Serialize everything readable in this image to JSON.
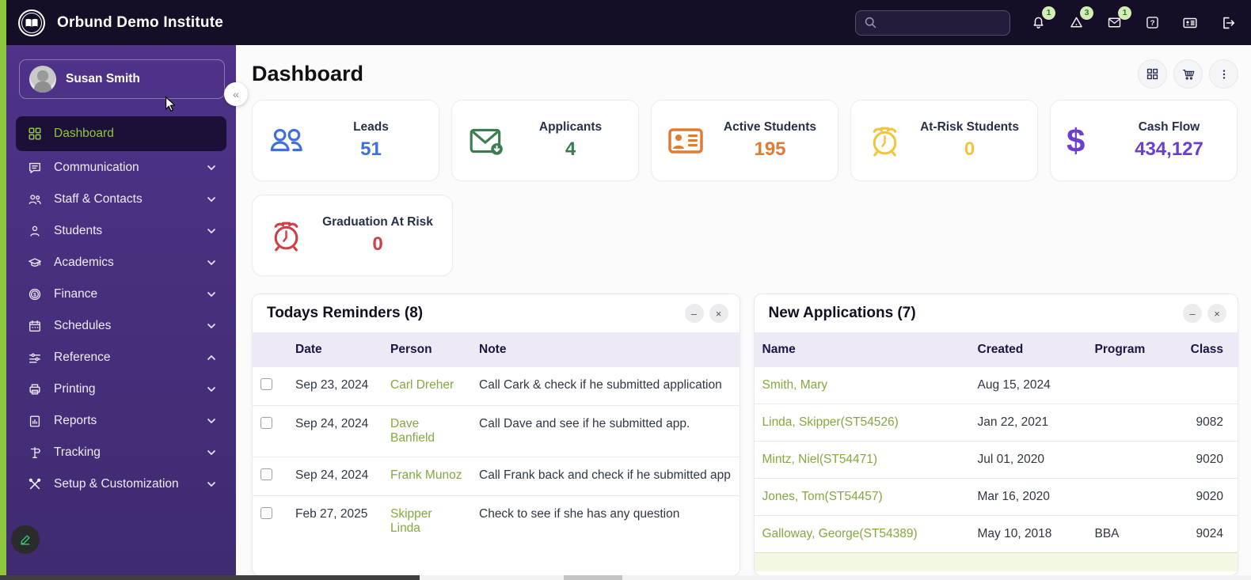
{
  "theme": {
    "topbar_bg": "#150e26",
    "sidebar_bg": "#4e3389",
    "accent_lime": "#8dc63f",
    "link_green": "#84a83e",
    "table_header_bg": "#edeaf6"
  },
  "topbar": {
    "brand": "Orbund Demo Institute",
    "search": {
      "value": "",
      "placeholder": ""
    },
    "badges": {
      "bell": "1",
      "alarm": "3",
      "mail": "1"
    }
  },
  "sidebar": {
    "user": {
      "name": "Susan Smith"
    },
    "collapse_glyph": "«",
    "items": [
      {
        "label": "Dashboard",
        "icon": "grid-icon",
        "active": true,
        "chevron": "none"
      },
      {
        "label": "Communication",
        "icon": "chat-icon",
        "chevron": "down"
      },
      {
        "label": "Staff & Contacts",
        "icon": "people-icon",
        "chevron": "down"
      },
      {
        "label": "Students",
        "icon": "person-icon",
        "chevron": "down"
      },
      {
        "label": "Academics",
        "icon": "grad-cap-icon",
        "chevron": "down"
      },
      {
        "label": "Finance",
        "icon": "coin-icon",
        "chevron": "down"
      },
      {
        "label": "Schedules",
        "icon": "calendar-icon",
        "chevron": "down"
      },
      {
        "label": "Reference",
        "icon": "sliders-icon",
        "chevron": "up"
      },
      {
        "label": "Printing",
        "icon": "printer-icon",
        "chevron": "down"
      },
      {
        "label": "Reports",
        "icon": "report-icon",
        "chevron": "down"
      },
      {
        "label": "Tracking",
        "icon": "signpost-icon",
        "chevron": "down"
      },
      {
        "label": "Setup & Customization",
        "icon": "tools-icon",
        "chevron": "down"
      }
    ]
  },
  "page": {
    "title": "Dashboard"
  },
  "stats": [
    {
      "label": "Leads",
      "value": "51",
      "color": "#3e6ee0",
      "icon": "leads-people-icon"
    },
    {
      "label": "Applicants",
      "value": "4",
      "color": "#3a7d4f",
      "icon": "mail-download-icon"
    },
    {
      "label": "Active Students",
      "value": "195",
      "color": "#e07b35",
      "icon": "id-card-icon"
    },
    {
      "label": "At-Risk Students",
      "value": "0",
      "color": "#f2c43d",
      "icon": "alarm-clock-icon"
    },
    {
      "label": "Cash Flow",
      "value": "434,127",
      "color": "#6a3fd0",
      "icon": "dollar-icon"
    },
    {
      "label": "Graduation At Risk",
      "value": "0",
      "color": "#cf3d45",
      "icon": "alarm-clock-icon"
    }
  ],
  "window_controls": {
    "minimize": "–",
    "close": "×"
  },
  "reminders": {
    "title": "Todays Reminders (8)",
    "columns": [
      "Date",
      "Person",
      "Note"
    ],
    "rows": [
      {
        "date": "Sep 23, 2024",
        "person": "Carl Dreher",
        "note": "Call Cark & check if he submitted application"
      },
      {
        "date": "Sep 24, 2024",
        "person": "Dave Banfield",
        "note": "Call Dave and see if he submitted app."
      },
      {
        "date": "Sep 24, 2024",
        "person": "Frank Munoz",
        "note": "Call Frank back and check if he submitted app"
      },
      {
        "date": "Feb 27, 2025",
        "person": "Skipper Linda",
        "note": "Check to see if she has any question"
      }
    ]
  },
  "applications": {
    "title": "New Applications (7)",
    "columns": [
      "Name",
      "Created",
      "Program",
      "Class"
    ],
    "rows": [
      {
        "name": "Smith, Mary",
        "created": "Aug 15, 2024",
        "program": "",
        "class": ""
      },
      {
        "name": "Linda, Skipper(ST54526)",
        "created": "Jan 22, 2021",
        "program": "",
        "class": "9082"
      },
      {
        "name": "Mintz, Niel(ST54471)",
        "created": "Jul 01, 2020",
        "program": "",
        "class": "9020"
      },
      {
        "name": "Jones, Tom(ST54457)",
        "created": "Mar 16, 2020",
        "program": "",
        "class": "9020"
      },
      {
        "name": "Galloway, George(ST54389)",
        "created": "May 10, 2018",
        "program": "BBA",
        "class": "9024"
      }
    ]
  }
}
